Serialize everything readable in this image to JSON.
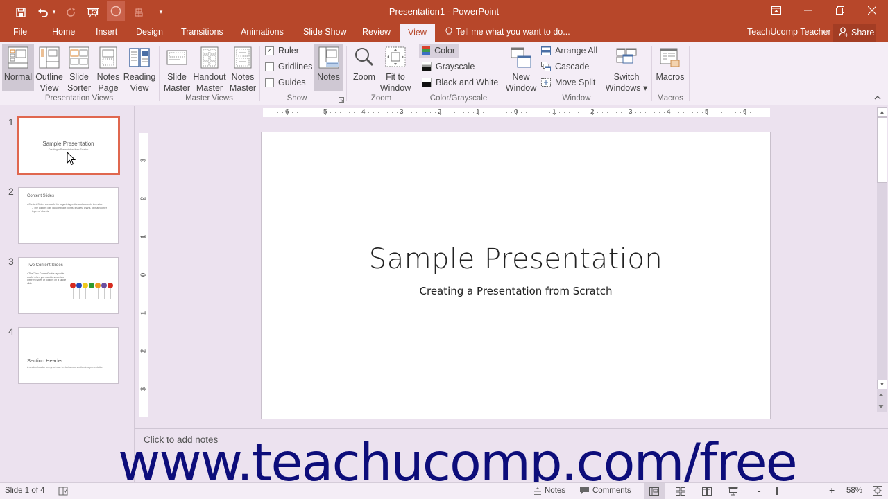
{
  "window": {
    "title": "Presentation1 - PowerPoint",
    "controls": {
      "ribbon_display": "⧉",
      "minimize": "—",
      "restore": "❐",
      "close": "✕"
    }
  },
  "qat": {
    "save": "💾",
    "undo": "↶",
    "undo_dropdown": "▾",
    "redo": "↻",
    "present": "⊡",
    "record": "◯",
    "align": "⊥",
    "customize": "▾"
  },
  "tabs": [
    {
      "label": "File"
    },
    {
      "label": "Home"
    },
    {
      "label": "Insert"
    },
    {
      "label": "Design"
    },
    {
      "label": "Transitions"
    },
    {
      "label": "Animations"
    },
    {
      "label": "Slide Show"
    },
    {
      "label": "Review"
    },
    {
      "label": "View",
      "active": true
    }
  ],
  "tell_me": {
    "icon": "lightbulb-icon",
    "placeholder": "Tell me what you want to do..."
  },
  "user": {
    "name": "TeachUcomp Teacher",
    "share": "Share"
  },
  "ribbon": {
    "presentation_views": {
      "label": "Presentation Views",
      "buttons": [
        {
          "line1": "Normal",
          "line2": "",
          "selected": true
        },
        {
          "line1": "Outline",
          "line2": "View"
        },
        {
          "line1": "Slide",
          "line2": "Sorter"
        },
        {
          "line1": "Notes",
          "line2": "Page"
        },
        {
          "line1": "Reading",
          "line2": "View"
        }
      ]
    },
    "master_views": {
      "label": "Master Views",
      "buttons": [
        {
          "line1": "Slide",
          "line2": "Master"
        },
        {
          "line1": "Handout",
          "line2": "Master"
        },
        {
          "line1": "Notes",
          "line2": "Master"
        }
      ]
    },
    "show": {
      "label": "Show",
      "checkboxes": [
        {
          "label": "Ruler",
          "checked": true
        },
        {
          "label": "Gridlines",
          "checked": false
        },
        {
          "label": "Guides",
          "checked": false
        }
      ],
      "notes_button": {
        "label": "Notes",
        "selected": true
      }
    },
    "zoom": {
      "label": "Zoom",
      "buttons": [
        {
          "line1": "Zoom",
          "line2": ""
        },
        {
          "line1": "Fit to",
          "line2": "Window"
        }
      ]
    },
    "color_grayscale": {
      "label": "Color/Grayscale",
      "items": [
        {
          "label": "Color",
          "selected": true
        },
        {
          "label": "Grayscale"
        },
        {
          "label": "Black and White"
        }
      ]
    },
    "window": {
      "label": "Window",
      "new_window": {
        "line1": "New",
        "line2": "Window"
      },
      "items": [
        {
          "label": "Arrange All"
        },
        {
          "label": "Cascade"
        },
        {
          "label": "Move Split"
        }
      ],
      "switch_windows": {
        "line1": "Switch",
        "line2": "Windows ▾"
      }
    },
    "macros": {
      "label": "Macros",
      "button": "Macros"
    }
  },
  "thumbnails": [
    {
      "number": "1",
      "title": "Sample Presentation",
      "subtitle": "Creating a Presentation from Scratch",
      "active": true
    },
    {
      "number": "2",
      "title": "Content Slides",
      "bullets": [
        "Content Slides are useful for organizing a title and contents in a slide",
        "The content can include bullet points, images, charts, or many other types of objects"
      ]
    },
    {
      "number": "3",
      "title": "Two Content Slides",
      "bullets": [
        "The \"Two Content\" slide layout is useful when you want to show two different types of content on a single slide"
      ],
      "image_letters": [
        "C",
        "O",
        "N",
        "T",
        "E",
        "N",
        "T"
      ]
    },
    {
      "number": "4",
      "title": "Section Header",
      "subtitle": "A section header is a great way to start a new section in a presentation"
    }
  ],
  "rulers": {
    "horizontal": [
      "6",
      "5",
      "4",
      "3",
      "2",
      "1",
      "0",
      "1",
      "2",
      "3",
      "4",
      "5",
      "6"
    ],
    "vertical": [
      "3",
      "2",
      "1",
      "0",
      "1",
      "2",
      "3"
    ]
  },
  "slide": {
    "title": "Sample Presentation",
    "subtitle": "Creating a Presentation from Scratch"
  },
  "notes": {
    "placeholder": "Click to add notes"
  },
  "watermark": "www.teachucomp.com/free",
  "statusbar": {
    "slide_info": "Slide 1 of 4",
    "notes": "Notes",
    "comments": "Comments",
    "zoom_level": "58%",
    "zoom_fraction": 0.16
  }
}
